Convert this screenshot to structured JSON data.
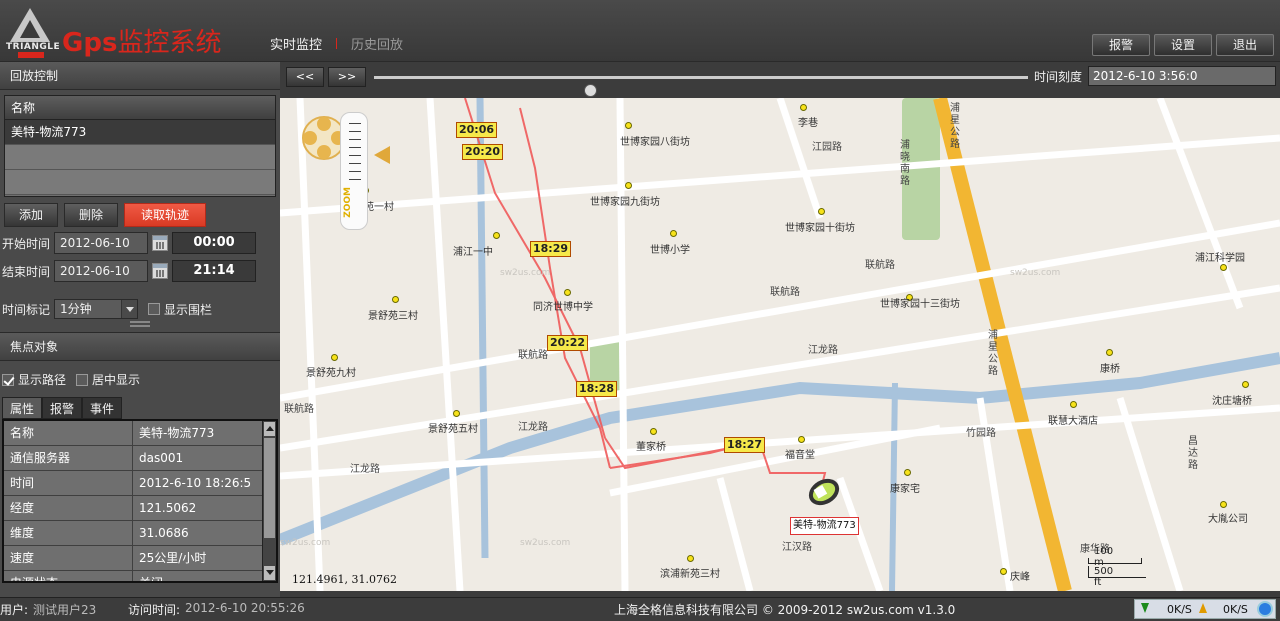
{
  "app": {
    "logo_text": "TRIANGLE",
    "title_latin": "Gps",
    "title_cn": "监控系统"
  },
  "nav": {
    "tabs": [
      "实时监控",
      "历史回放"
    ],
    "active": "实时监控"
  },
  "header_buttons": [
    "报警",
    "设置",
    "退出"
  ],
  "playback_panel": {
    "title": "回放控制",
    "list_header": "名称",
    "items": [
      "美特-物流773"
    ],
    "buttons": {
      "add": "添加",
      "delete": "删除",
      "read_track": "读取轨迹"
    },
    "start": {
      "label": "开始时间",
      "date": "2012-06-10",
      "time": "00:00"
    },
    "end": {
      "label": "结束时间",
      "date": "2012-06-10",
      "time": "21:14"
    },
    "interval": {
      "label": "时间标记",
      "value": "1分钟"
    },
    "show_fence": {
      "label": "显示围栏",
      "checked": false
    }
  },
  "focus_panel": {
    "title": "焦点对象",
    "show_path": {
      "label": "显示路径",
      "checked": true
    },
    "center": {
      "label": "居中显示",
      "checked": false
    },
    "tabs": [
      "属性",
      "报警",
      "事件"
    ],
    "active_tab": "属性",
    "properties": [
      {
        "key": "名称",
        "value": "美特-物流773"
      },
      {
        "key": "通信服务器",
        "value": "das001"
      },
      {
        "key": "时间",
        "value": "2012-6-10 18:26:5"
      },
      {
        "key": "经度",
        "value": "121.5062"
      },
      {
        "key": "维度",
        "value": "31.0686"
      },
      {
        "key": "速度",
        "value": "25公里/小时"
      },
      {
        "key": "电源状态",
        "value": "关闭"
      }
    ]
  },
  "playbar": {
    "prev": "<<",
    "next": ">>",
    "progress": 0.33,
    "label": "时间刻度",
    "time": "2012-6-10 3:56:0"
  },
  "map": {
    "time_tags": [
      "20:06",
      "20:20",
      "18:29",
      "20:22",
      "18:28",
      "18:27"
    ],
    "vehicle_label": "美特-物流773",
    "coordinates": "121.4961, 31.0762",
    "scale": {
      "top": "100 m",
      "bottom": "500 ft"
    },
    "zoom_label": "ZOOM",
    "watermark": "sw2us.com",
    "pois": [
      "李巷",
      "世博家园八街坊",
      "世博家园九街坊",
      "世博家园十街坊",
      "世博小学",
      "浦江一中",
      "景苑一村",
      "同济世博中学",
      "景舒苑三村",
      "景舒苑九村",
      "景舒苑五村",
      "世博家园十三街坊",
      "浦江科学园",
      "康桥",
      "沈庄塘桥",
      "联慧大酒店",
      "董家桥",
      "福音堂",
      "康家宅",
      "大胤公司",
      "滨浦新苑三村",
      "庆峰"
    ],
    "roads": [
      "江园路",
      "浦晓南路",
      "联航路",
      "联航路",
      "联航路",
      "江龙路",
      "江龙路",
      "江龙路",
      "联航路",
      "竹园路",
      "江汉路",
      "浦星公路",
      "浦星公路",
      "昌达路",
      "康华路"
    ]
  },
  "status": {
    "user_label": "用户:",
    "user": "测试用户23",
    "visit_label": "访问时间:",
    "visit_time": "2012-6-10 20:55:26",
    "copyright": "上海全格信息科技有限公司 © 2009-2012 sw2us.com  v1.3.0",
    "down_rate": "0K/S",
    "up_rate": "0K/S"
  }
}
